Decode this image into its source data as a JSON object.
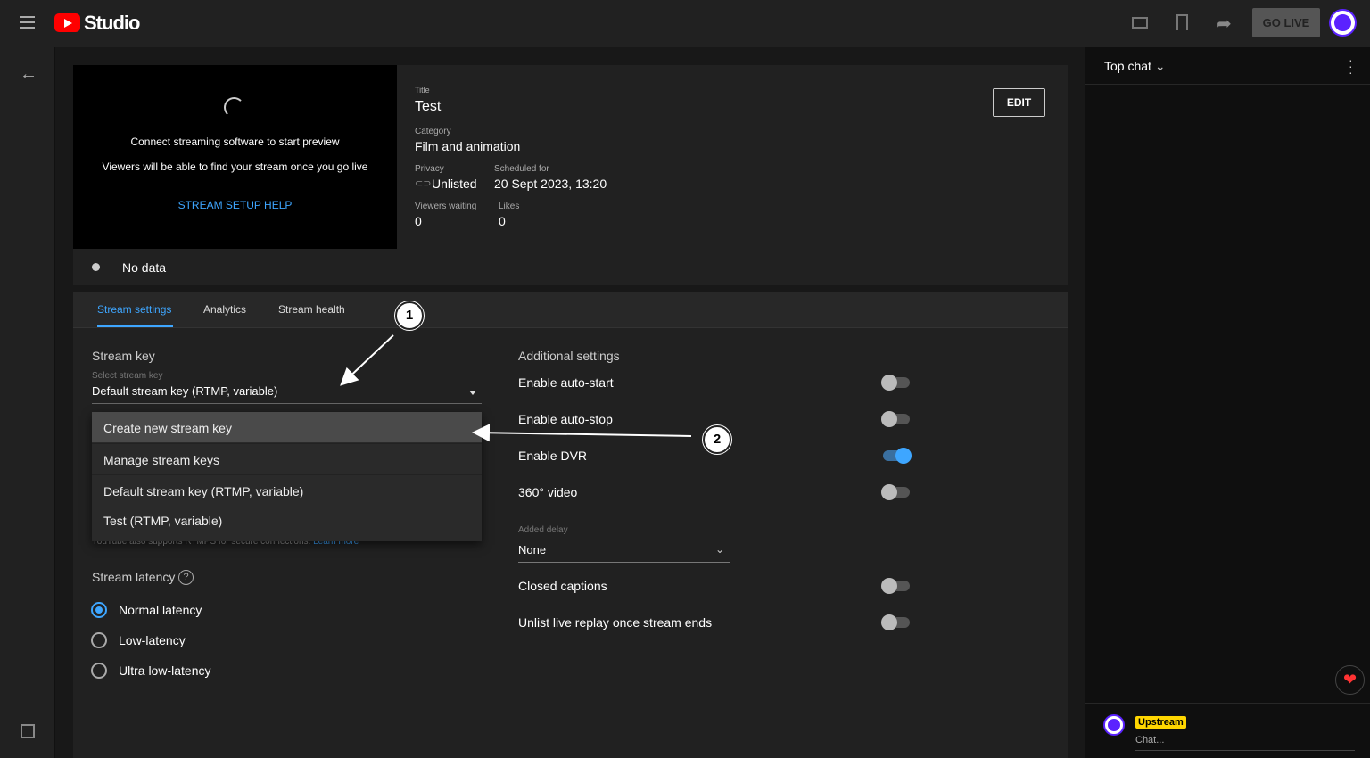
{
  "header": {
    "app": "Studio",
    "go_live": "GO LIVE"
  },
  "preview": {
    "line1": "Connect streaming software to start preview",
    "line2": "Viewers will be able to find your stream once you go live",
    "help": "STREAM SETUP HELP",
    "status": "No data"
  },
  "details": {
    "title_label": "Title",
    "title": "Test",
    "category_label": "Category",
    "category": "Film and animation",
    "privacy_label": "Privacy",
    "privacy": "Unlisted",
    "scheduled_label": "Scheduled for",
    "scheduled": "20 Sept 2023, 13:20",
    "viewers_label": "Viewers waiting",
    "viewers": "0",
    "likes_label": "Likes",
    "likes": "0",
    "edit": "EDIT"
  },
  "tabs": [
    "Stream settings",
    "Analytics",
    "Stream health"
  ],
  "stream_key": {
    "heading": "Stream key",
    "select_label": "Select stream key",
    "selected": "Default stream key (RTMP, variable)",
    "menu": [
      "Create new stream key",
      "Manage stream keys",
      "Default stream key (RTMP, variable)",
      "Test (RTMP, variable)"
    ],
    "rtmps_note": "YouTube also supports RTMPS for secure connections.",
    "learn_more": "Learn more"
  },
  "latency": {
    "heading": "Stream latency",
    "options": [
      "Normal latency",
      "Low-latency",
      "Ultra low-latency"
    ],
    "selected": "Normal latency"
  },
  "additional": {
    "heading": "Additional settings",
    "toggles": [
      {
        "label": "Enable auto-start",
        "on": false
      },
      {
        "label": "Enable auto-stop",
        "on": false
      },
      {
        "label": "Enable DVR",
        "on": true
      },
      {
        "label": "360° video",
        "on": false
      }
    ],
    "delay_label": "Added delay",
    "delay": "None",
    "toggles2": [
      {
        "label": "Closed captions",
        "on": false
      },
      {
        "label": "Unlist live replay once stream ends",
        "on": false
      }
    ]
  },
  "chat": {
    "mode": "Top chat",
    "user": "Upstream",
    "placeholder": "Chat..."
  },
  "callouts": [
    "1",
    "2"
  ],
  "colors": {
    "accent": "#3ea6ff",
    "brand": "#ff0000",
    "badge": "#ffd600"
  }
}
